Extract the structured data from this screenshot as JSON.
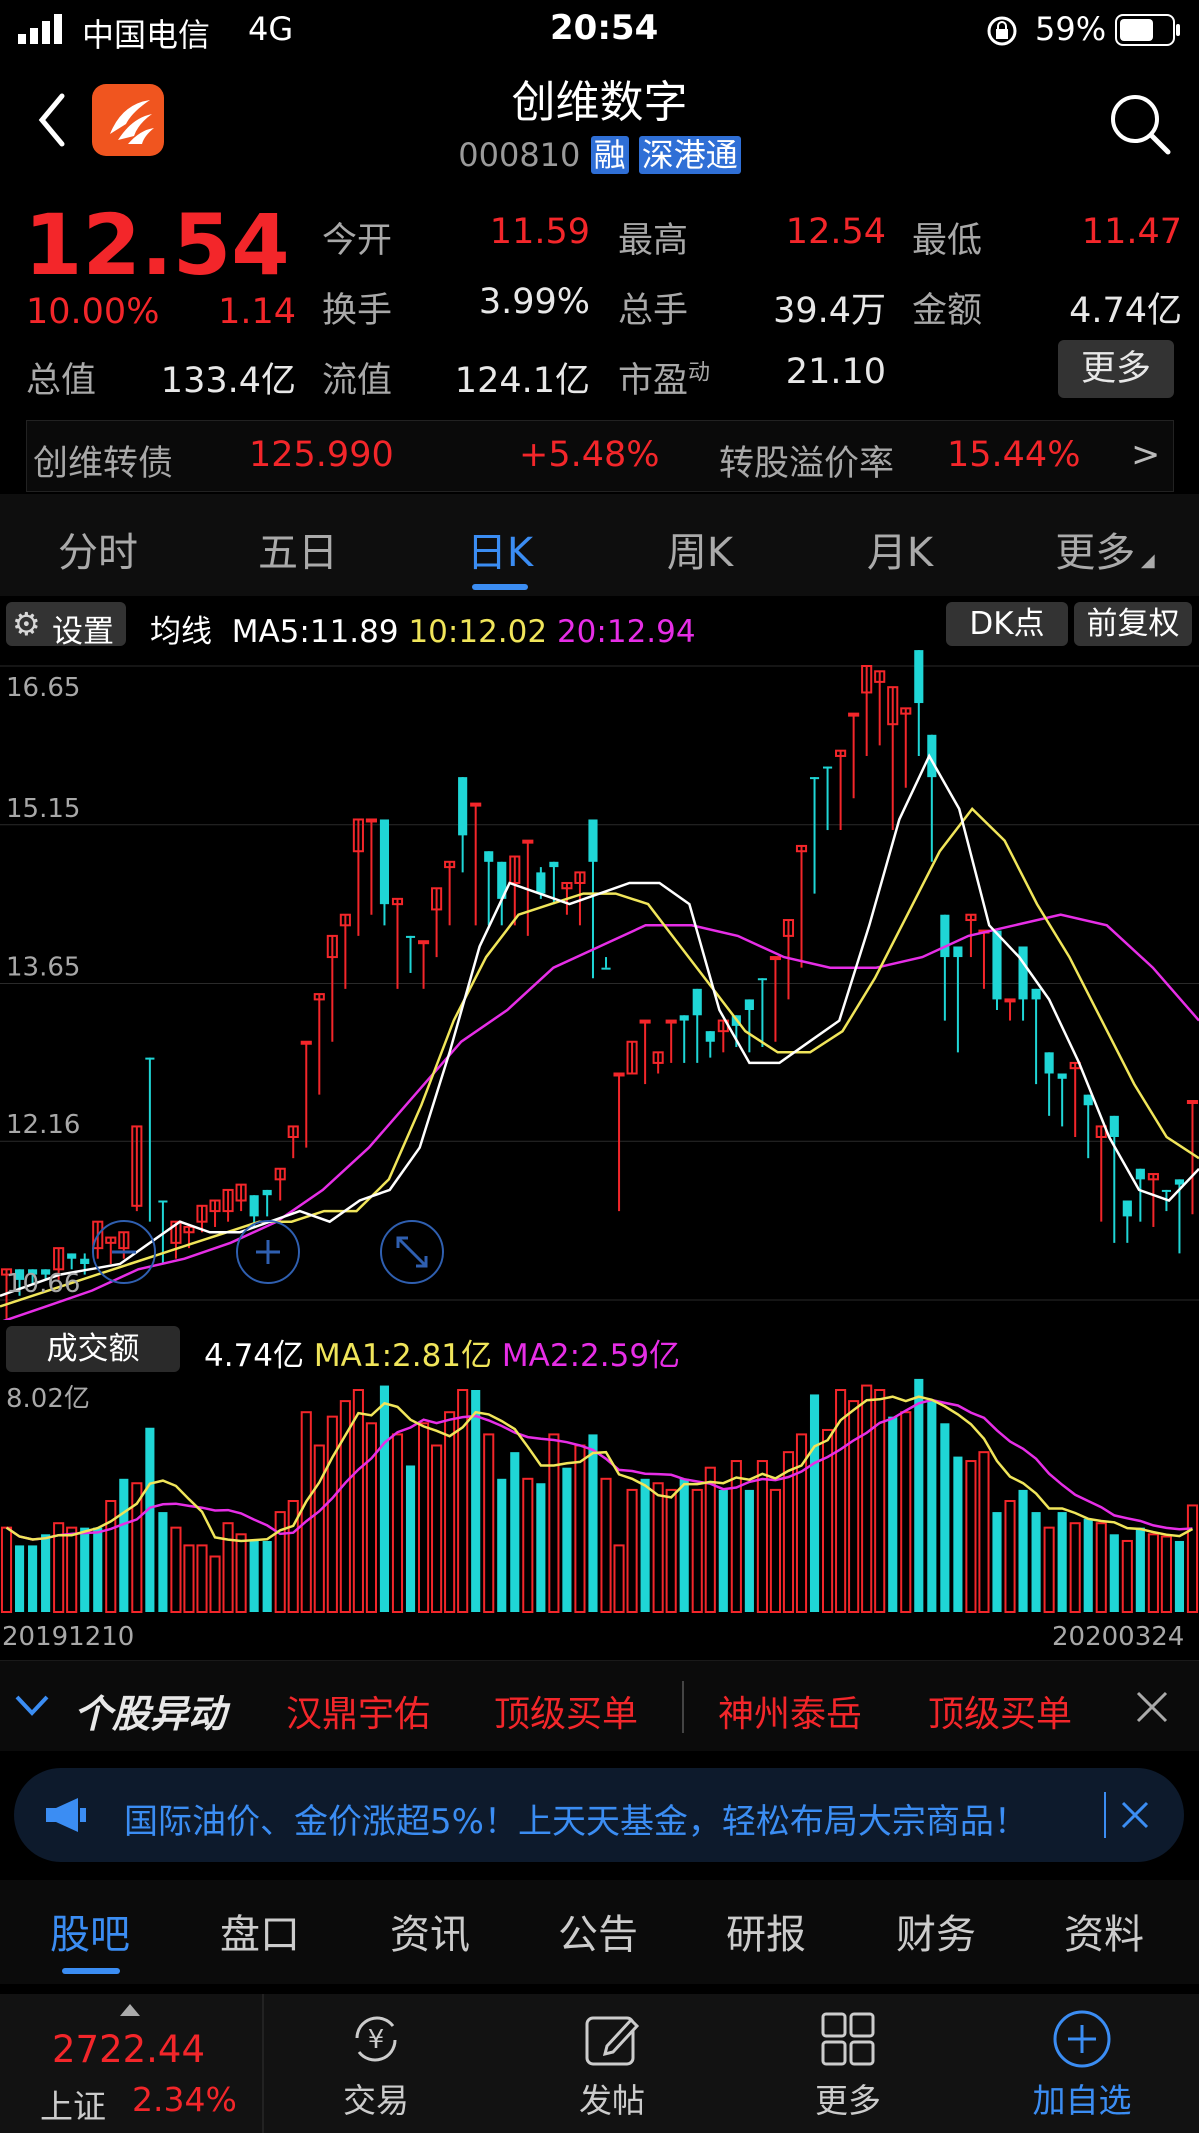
{
  "status_bar": {
    "carrier": "中国电信",
    "network": "4G",
    "time": "20:54",
    "battery": "59%"
  },
  "header": {
    "title": "创维数字",
    "code": "000810",
    "badge_rong": "融",
    "badge_sgt": "深港通"
  },
  "quote": {
    "price": "12.54",
    "change_pct": "10.00%",
    "change": "1.14",
    "open_label": "今开",
    "open": "11.59",
    "high_label": "最高",
    "high": "12.54",
    "low_label": "最低",
    "low": "11.47",
    "turnover_label": "换手",
    "turnover": "3.99%",
    "volume_label": "总手",
    "volume": "39.4万",
    "amount_label": "金额",
    "amount": "4.74亿",
    "mktcap_label": "总值",
    "mktcap": "133.4亿",
    "float_label": "流值",
    "float": "124.1亿",
    "pe_label": "市盈",
    "pe_sup": "动",
    "pe": "21.10",
    "more": "更多"
  },
  "bond": {
    "name": "创维转债",
    "price": "125.990",
    "change": "+5.48%",
    "premium_label": "转股溢价率",
    "premium": "15.44%",
    "arrow": ">"
  },
  "period_tabs": [
    "分时",
    "五日",
    "日K",
    "周K",
    "月K",
    "更多"
  ],
  "active_tab": "日K",
  "ma_bar": {
    "settings": "设置",
    "ma_label": "均线",
    "ma5": "MA5:11.89",
    "ma10": "10:12.02",
    "ma20": "20:12.94",
    "dk": "DK点",
    "adjust": "前复权"
  },
  "chart_data": {
    "type": "candlestick",
    "y_ticks": [
      "16.65",
      "15.15",
      "13.65",
      "12.16",
      "10.66"
    ],
    "ylim": [
      10.66,
      16.65
    ],
    "volume_label": "成交额",
    "volume_value": "4.74亿",
    "volume_ma1": "MA1:2.81亿",
    "volume_ma2": "MA2:2.59亿",
    "volume_max_label": "8.02亿",
    "date_start": "20191210",
    "date_end": "20200324",
    "colors": {
      "up": "#f3262a",
      "down": "#1fd6d6",
      "ma5": "#ffffff",
      "ma10": "#f0e55a",
      "ma20": "#e62ee6",
      "vol_ma1": "#f0e55a",
      "vol_ma2": "#e62ee6"
    },
    "candles": [
      [
        10.9,
        10.95,
        10.65,
        10.45,
        "u"
      ],
      [
        10.85,
        10.95,
        10.8,
        10.7,
        "d"
      ],
      [
        10.9,
        10.95,
        10.85,
        10.8,
        "d"
      ],
      [
        10.9,
        10.95,
        10.88,
        10.85,
        "d"
      ],
      [
        10.95,
        11.15,
        10.9,
        10.85,
        "u"
      ],
      [
        11.05,
        11.1,
        11.0,
        10.95,
        "d"
      ],
      [
        11.05,
        11.0,
        11.1,
        10.9,
        "d"
      ],
      [
        11.15,
        11.4,
        11.1,
        11.05,
        "u"
      ],
      [
        11.2,
        11.25,
        11.05,
        11.0,
        "u"
      ],
      [
        11.15,
        11.3,
        11.1,
        11.05,
        "u"
      ],
      [
        11.55,
        12.3,
        11.55,
        11.5,
        "u"
      ],
      [
        12.95,
        12.95,
        11.95,
        11.4,
        "d"
      ],
      [
        11.6,
        11.6,
        11.1,
        11.0,
        "d"
      ],
      [
        11.2,
        11.4,
        11.2,
        11.05,
        "u"
      ],
      [
        11.3,
        11.35,
        11.25,
        11.15,
        "u"
      ],
      [
        11.4,
        11.55,
        11.4,
        11.3,
        "u"
      ],
      [
        11.5,
        11.6,
        11.5,
        11.35,
        "u"
      ],
      [
        11.5,
        11.7,
        11.5,
        11.4,
        "u"
      ],
      [
        11.6,
        11.75,
        11.6,
        11.5,
        "u"
      ],
      [
        11.65,
        11.45,
        11.6,
        11.35,
        "d"
      ],
      [
        11.65,
        11.7,
        11.5,
        11.45,
        "d"
      ],
      [
        11.8,
        11.9,
        11.75,
        11.6,
        "u"
      ],
      [
        12.2,
        12.3,
        12.1,
        12.0,
        "u"
      ],
      [
        13.1,
        13.1,
        12.2,
        12.1,
        "u"
      ],
      [
        13.5,
        13.55,
        12.7,
        12.6,
        "u"
      ],
      [
        13.9,
        14.1,
        13.2,
        13.1,
        "u"
      ],
      [
        14.2,
        14.3,
        13.7,
        13.6,
        "u"
      ],
      [
        14.9,
        15.2,
        14.2,
        14.1,
        "u"
      ],
      [
        15.2,
        15.2,
        14.4,
        14.3,
        "u"
      ],
      [
        15.2,
        14.4,
        15.2,
        14.2,
        "d"
      ],
      [
        14.45,
        14.4,
        14.0,
        13.6,
        "u"
      ],
      [
        14.1,
        14.1,
        14.0,
        13.75,
        "d"
      ],
      [
        14.05,
        14.05,
        13.7,
        13.6,
        "u"
      ],
      [
        14.35,
        14.55,
        14.05,
        13.9,
        "u"
      ],
      [
        14.75,
        14.8,
        14.35,
        14.2,
        "u"
      ],
      [
        15.05,
        15.6,
        14.8,
        14.7,
        "d"
      ],
      [
        15.35,
        15.35,
        14.3,
        14.2,
        "u"
      ],
      [
        14.9,
        14.8,
        14.3,
        14.2,
        "d"
      ],
      [
        14.45,
        14.8,
        14.4,
        14.2,
        "d"
      ],
      [
        14.6,
        14.85,
        14.3,
        14.2,
        "u"
      ],
      [
        15.0,
        15.0,
        14.2,
        14.1,
        "u"
      ],
      [
        14.7,
        14.5,
        14.75,
        14.45,
        "d"
      ],
      [
        14.8,
        14.75,
        14.55,
        14.4,
        "d"
      ],
      [
        14.6,
        14.55,
        14.4,
        14.3,
        "u"
      ],
      [
        14.7,
        14.6,
        14.45,
        14.2,
        "u"
      ],
      [
        15.2,
        14.8,
        14.1,
        13.7,
        "d"
      ],
      [
        13.8,
        13.8,
        13.9,
        13.8,
        "d"
      ],
      [
        12.8,
        12.8,
        12.8,
        11.5,
        "u"
      ],
      [
        13.1,
        12.8,
        13.05,
        12.8,
        "u"
      ],
      [
        13.3,
        13.3,
        12.9,
        12.7,
        "u"
      ],
      [
        13.0,
        12.9,
        13.0,
        12.8,
        "u"
      ],
      [
        13.3,
        13.3,
        13.05,
        12.9,
        "u"
      ],
      [
        13.35,
        13.3,
        13.2,
        12.9,
        "d"
      ],
      [
        13.6,
        13.35,
        13.25,
        12.9,
        "d"
      ],
      [
        13.2,
        13.1,
        13.1,
        12.95,
        "d"
      ],
      [
        13.3,
        13.2,
        13.2,
        13.0,
        "u"
      ],
      [
        13.35,
        13.25,
        13.35,
        13.05,
        "d"
      ],
      [
        13.4,
        13.5,
        13.1,
        13.0,
        "d"
      ],
      [
        13.7,
        13.7,
        13.2,
        13.05,
        "d"
      ],
      [
        13.9,
        13.9,
        13.25,
        13.1,
        "u"
      ],
      [
        14.1,
        14.25,
        13.85,
        13.5,
        "u"
      ],
      [
        14.9,
        14.95,
        14.0,
        13.8,
        "u"
      ],
      [
        15.6,
        15.6,
        14.9,
        14.5,
        "d"
      ],
      [
        15.7,
        15.7,
        15.25,
        15.1,
        "d"
      ],
      [
        15.8,
        15.85,
        15.4,
        15.1,
        "u"
      ],
      [
        16.2,
        16.2,
        15.85,
        15.4,
        "u"
      ],
      [
        16.65,
        16.4,
        16.1,
        15.8,
        "u"
      ],
      [
        16.6,
        16.5,
        16.0,
        15.9,
        "u"
      ],
      [
        16.45,
        16.1,
        15.7,
        15.1,
        "u"
      ],
      [
        16.2,
        16.25,
        15.85,
        15.5,
        "u"
      ],
      [
        16.8,
        16.3,
        15.95,
        15.8,
        "d"
      ],
      [
        16.0,
        15.6,
        15.2,
        14.8,
        "d"
      ],
      [
        14.3,
        13.9,
        13.9,
        13.3,
        "d"
      ],
      [
        14.0,
        13.9,
        13.5,
        13.0,
        "d"
      ],
      [
        14.3,
        14.25,
        14.0,
        13.9,
        "u"
      ],
      [
        14.15,
        14.15,
        13.8,
        13.6,
        "u"
      ],
      [
        14.15,
        13.5,
        13.6,
        13.4,
        "d"
      ],
      [
        13.5,
        13.5,
        13.4,
        13.3,
        "u"
      ],
      [
        14.0,
        13.5,
        13.6,
        13.3,
        "d"
      ],
      [
        13.5,
        13.6,
        12.9,
        12.7,
        "d"
      ],
      [
        13.0,
        12.8,
        12.45,
        12.4,
        "d"
      ],
      [
        12.8,
        12.75,
        12.5,
        12.3,
        "d"
      ],
      [
        12.9,
        12.85,
        12.5,
        12.2,
        "u"
      ],
      [
        12.6,
        12.5,
        12.1,
        12.0,
        "d"
      ],
      [
        12.2,
        12.3,
        11.5,
        11.4,
        "u"
      ],
      [
        12.4,
        12.2,
        11.4,
        11.2,
        "d"
      ],
      [
        11.6,
        11.45,
        11.35,
        11.2,
        "d"
      ],
      [
        11.9,
        11.8,
        11.5,
        11.4,
        "d"
      ],
      [
        11.8,
        11.85,
        11.6,
        11.35,
        "u"
      ],
      [
        11.7,
        11.7,
        11.6,
        11.5,
        "d"
      ],
      [
        11.8,
        11.75,
        11.3,
        11.1,
        "d"
      ],
      [
        12.54,
        12.54,
        11.59,
        11.47,
        "u"
      ]
    ],
    "ma5_line": [
      10.7,
      10.8,
      10.9,
      10.95,
      11.0,
      11.2,
      11.4,
      11.3,
      11.3,
      11.4,
      11.5,
      11.4,
      11.6,
      11.7,
      12.1,
      13.0,
      14.0,
      14.6,
      14.5,
      14.4,
      14.5,
      14.6,
      14.6,
      14.4,
      13.4,
      12.9,
      12.9,
      13.1,
      13.3,
      14.2,
      15.2,
      15.8,
      15.3,
      14.2,
      13.9,
      13.5,
      12.9,
      12.2,
      11.7,
      11.6,
      11.9
    ],
    "ma10_line": [
      10.6,
      10.7,
      10.8,
      10.9,
      11.0,
      11.1,
      11.2,
      11.3,
      11.4,
      11.4,
      11.5,
      11.5,
      11.8,
      12.5,
      13.3,
      13.9,
      14.3,
      14.4,
      14.5,
      14.5,
      14.4,
      14.0,
      13.6,
      13.2,
      13.0,
      13.0,
      13.2,
      13.7,
      14.3,
      14.9,
      15.3,
      15.0,
      14.4,
      13.9,
      13.3,
      12.7,
      12.2,
      12.0
    ],
    "ma20_line": [
      10.45,
      10.6,
      10.75,
      10.95,
      11.05,
      11.2,
      11.4,
      11.7,
      12.1,
      12.6,
      13.1,
      13.4,
      13.8,
      14.0,
      14.2,
      14.2,
      14.1,
      13.9,
      13.8,
      13.8,
      13.9,
      14.1,
      14.2,
      14.3,
      14.2,
      13.8,
      13.3
    ]
  },
  "volume_bars": [
    [
      0.38,
      "u"
    ],
    [
      0.3,
      "d"
    ],
    [
      0.3,
      "d"
    ],
    [
      0.35,
      "d"
    ],
    [
      0.4,
      "u"
    ],
    [
      0.38,
      "u"
    ],
    [
      0.38,
      "d"
    ],
    [
      0.38,
      "d"
    ],
    [
      0.5,
      "u"
    ],
    [
      0.6,
      "d"
    ],
    [
      0.58,
      "u"
    ],
    [
      0.83,
      "d"
    ],
    [
      0.45,
      "d"
    ],
    [
      0.38,
      "u"
    ],
    [
      0.3,
      "u"
    ],
    [
      0.3,
      "u"
    ],
    [
      0.25,
      "u"
    ],
    [
      0.4,
      "u"
    ],
    [
      0.35,
      "u"
    ],
    [
      0.32,
      "d"
    ],
    [
      0.32,
      "d"
    ],
    [
      0.45,
      "u"
    ],
    [
      0.5,
      "u"
    ],
    [
      0.9,
      "u"
    ],
    [
      0.75,
      "u"
    ],
    [
      0.88,
      "u"
    ],
    [
      0.95,
      "u"
    ],
    [
      1.0,
      "u"
    ],
    [
      0.85,
      "u"
    ],
    [
      1.02,
      "d"
    ],
    [
      0.8,
      "u"
    ],
    [
      0.66,
      "d"
    ],
    [
      0.85,
      "u"
    ],
    [
      0.75,
      "u"
    ],
    [
      0.9,
      "u"
    ],
    [
      1.0,
      "u"
    ],
    [
      1.0,
      "d"
    ],
    [
      0.8,
      "u"
    ],
    [
      0.6,
      "d"
    ],
    [
      0.72,
      "d"
    ],
    [
      0.6,
      "u"
    ],
    [
      0.58,
      "d"
    ],
    [
      0.8,
      "u"
    ],
    [
      0.65,
      "d"
    ],
    [
      0.75,
      "u"
    ],
    [
      0.8,
      "d"
    ],
    [
      0.6,
      "u"
    ],
    [
      0.3,
      "u"
    ],
    [
      0.55,
      "u"
    ],
    [
      0.6,
      "d"
    ],
    [
      0.58,
      "u"
    ],
    [
      0.55,
      "u"
    ],
    [
      0.6,
      "d"
    ],
    [
      0.55,
      "u"
    ],
    [
      0.65,
      "u"
    ],
    [
      0.55,
      "d"
    ],
    [
      0.68,
      "u"
    ],
    [
      0.55,
      "d"
    ],
    [
      0.68,
      "u"
    ],
    [
      0.55,
      "u"
    ],
    [
      0.72,
      "u"
    ],
    [
      0.8,
      "u"
    ],
    [
      0.98,
      "d"
    ],
    [
      0.82,
      "u"
    ],
    [
      1.0,
      "u"
    ],
    [
      0.95,
      "u"
    ],
    [
      1.02,
      "u"
    ],
    [
      1.0,
      "u"
    ],
    [
      0.88,
      "d"
    ],
    [
      0.9,
      "u"
    ],
    [
      1.05,
      "d"
    ],
    [
      0.95,
      "d"
    ],
    [
      0.85,
      "d"
    ],
    [
      0.7,
      "d"
    ],
    [
      0.68,
      "u"
    ],
    [
      0.72,
      "u"
    ],
    [
      0.45,
      "d"
    ],
    [
      0.5,
      "u"
    ],
    [
      0.55,
      "d"
    ],
    [
      0.45,
      "d"
    ],
    [
      0.38,
      "u"
    ],
    [
      0.45,
      "d"
    ],
    [
      0.4,
      "u"
    ],
    [
      0.42,
      "d"
    ],
    [
      0.4,
      "u"
    ],
    [
      0.35,
      "d"
    ],
    [
      0.32,
      "u"
    ],
    [
      0.38,
      "d"
    ],
    [
      0.35,
      "u"
    ],
    [
      0.34,
      "u"
    ],
    [
      0.32,
      "d"
    ],
    [
      0.48,
      "u"
    ]
  ],
  "alert_bar": {
    "label": "个股异动",
    "item1_name": "汉鼎宇佑",
    "item1_tag": "顶级买单",
    "item2_name": "神州泰岳",
    "item2_tag": "顶级买单"
  },
  "ad_bar": {
    "text": "国际油价、金价涨超5%！上天天基金，轻松布局大宗商品！"
  },
  "section_tabs": [
    "股吧",
    "盘口",
    "资讯",
    "公告",
    "研报",
    "财务",
    "资料"
  ],
  "active_section": "股吧",
  "bottom_bar": {
    "index_value": "2722.44",
    "index_name": "上证",
    "index_change": "2.34%",
    "trade": "交易",
    "post": "发帖",
    "more": "更多",
    "add": "加自选"
  }
}
